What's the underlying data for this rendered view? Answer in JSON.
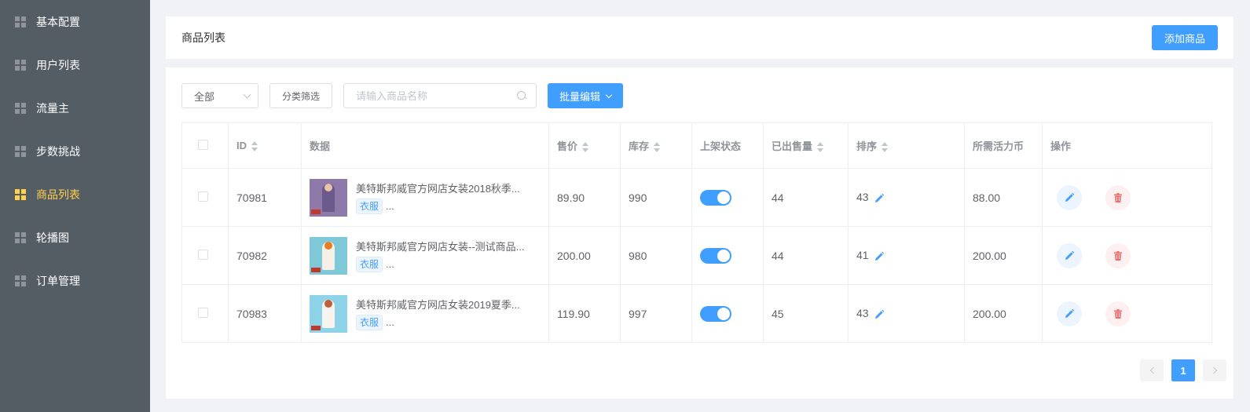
{
  "sidebar": {
    "items": [
      {
        "label": "基本配置",
        "active": false
      },
      {
        "label": "用户列表",
        "active": false
      },
      {
        "label": "流量主",
        "active": false
      },
      {
        "label": "步数挑战",
        "active": false
      },
      {
        "label": "商品列表",
        "active": true
      },
      {
        "label": "轮播图",
        "active": false
      },
      {
        "label": "订单管理",
        "active": false
      }
    ]
  },
  "header": {
    "title": "商品列表",
    "add_button": "添加商品"
  },
  "toolbar": {
    "select_value": "全部",
    "category_filter": "分类筛选",
    "search_placeholder": "请输入商品名称",
    "batch_edit": "批量编辑"
  },
  "table": {
    "headers": {
      "id": "ID",
      "data": "数据",
      "price": "售价",
      "stock": "库存",
      "status": "上架状态",
      "sold": "已出售量",
      "sort": "排序",
      "coins": "所需活力币",
      "actions": "操作"
    },
    "rows": [
      {
        "id": "70981",
        "name": "美特斯邦威官方网店女装2018秋季...",
        "tag": "衣服",
        "more": "...",
        "price": "89.90",
        "stock": "990",
        "on_sale": true,
        "sold": "44",
        "sort": "43",
        "coins": "88.00"
      },
      {
        "id": "70982",
        "name": "美特斯邦威官方网店女装--测试商品...",
        "tag": "衣服",
        "more": "...",
        "price": "200.00",
        "stock": "980",
        "on_sale": true,
        "sold": "44",
        "sort": "41",
        "coins": "200.00"
      },
      {
        "id": "70983",
        "name": "美特斯邦威官方网店女装2019夏季...",
        "tag": "衣服",
        "more": "...",
        "price": "119.90",
        "stock": "997",
        "on_sale": true,
        "sold": "45",
        "sort": "43",
        "coins": "200.00"
      }
    ]
  },
  "pagination": {
    "current": "1"
  },
  "colors": {
    "primary": "#409eff",
    "sidebar_bg": "#545c64",
    "active_nav": "#ffd04b",
    "danger": "#f56c6c"
  }
}
